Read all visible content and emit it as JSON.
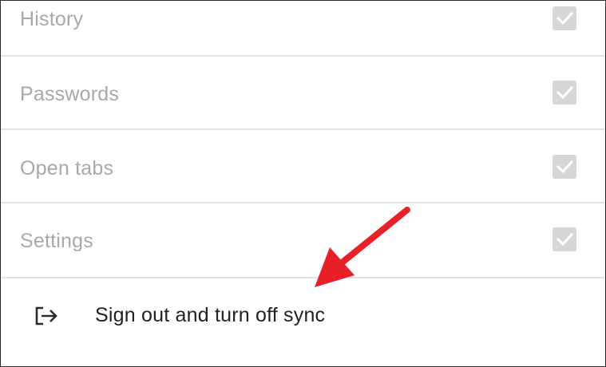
{
  "sync_items": [
    {
      "label": "History",
      "checked": true,
      "enabled": false
    },
    {
      "label": "Passwords",
      "checked": true,
      "enabled": false
    },
    {
      "label": "Open tabs",
      "checked": true,
      "enabled": false
    },
    {
      "label": "Settings",
      "checked": true,
      "enabled": false
    }
  ],
  "sign_out": {
    "label": "Sign out and turn off sync",
    "icon": "sign-out-icon"
  },
  "annotation": {
    "icon": "red-arrow-icon",
    "color": "#e8202a"
  },
  "colors": {
    "disabled_text": "#a8a8a8",
    "checkbox_disabled": "#d6d6d6",
    "primary_text": "#202124",
    "divider": "#e3e3e3"
  }
}
